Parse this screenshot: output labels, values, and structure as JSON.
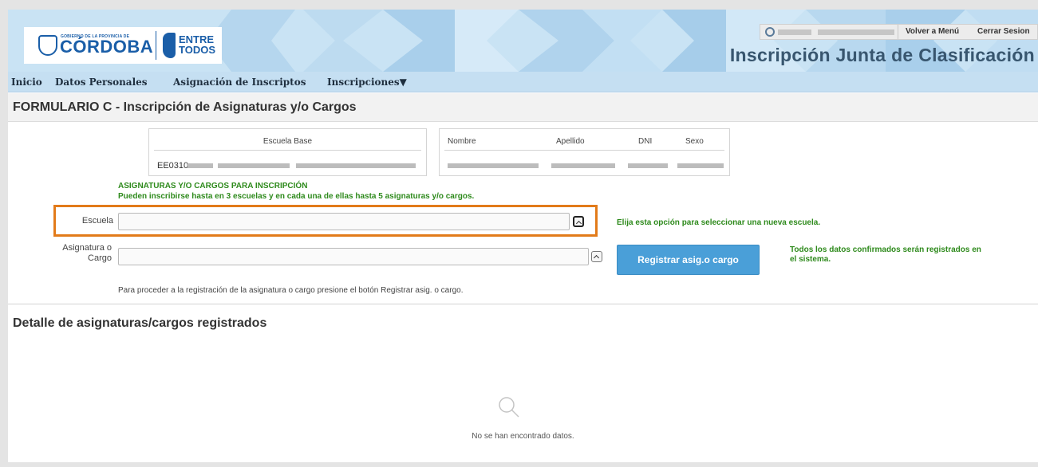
{
  "header": {
    "logo_gov_text": "GOBIERNO DE LA PROVINCIA DE",
    "logo_province": "CÓRDOBA",
    "logo_entre": "ENTRE",
    "logo_todos": "TODOS",
    "app_title": "Inscripción Junta de Clasificación",
    "user_links": {
      "back": "Volver a Menú",
      "logout": "Cerrar Sesion"
    }
  },
  "nav": {
    "items": [
      "Inicio",
      "Datos Personales",
      "Asignación de Inscriptos",
      "Inscripciones▼"
    ]
  },
  "form": {
    "title": "FORMULARIO C - Inscripción de Asignaturas y/o Cargos",
    "school_table": {
      "header": "Escuela Base",
      "value_prefix": "EE0310"
    },
    "person_table": {
      "headers": [
        "Nombre",
        "Apellido",
        "DNI",
        "Sexo"
      ]
    },
    "section_title": "ASIGNATURAS Y/O CARGOS PARA INSCRIPCIÓN",
    "section_subtitle": "Pueden inscribirse hasta en 3 escuelas y en cada una de ellas hasta 5 asignaturas y/o cargos.",
    "escuela_label": "Escuela",
    "asignatura_label_line1": "Asignatura o",
    "asignatura_label_line2": "Cargo",
    "escuela_hint": "Elija esta opción para seleccionar una nueva escuela.",
    "register_button": "Registrar asig.o cargo",
    "register_hint_line1": "Todos los datos confirmados serán registrados en",
    "register_hint_line2": "el sistema.",
    "note": "Para proceder a la registración de la asignatura o cargo presione el botón Registrar asig. o cargo."
  },
  "detail": {
    "title": "Detalle de asignaturas/cargos registrados",
    "empty_message": "No se han encontrado datos."
  },
  "colors": {
    "accent_blue": "#4a9fd8",
    "highlight_orange": "#e27b1a",
    "green_text": "#2e8a1c",
    "nav_bg": "#c5dff2"
  }
}
